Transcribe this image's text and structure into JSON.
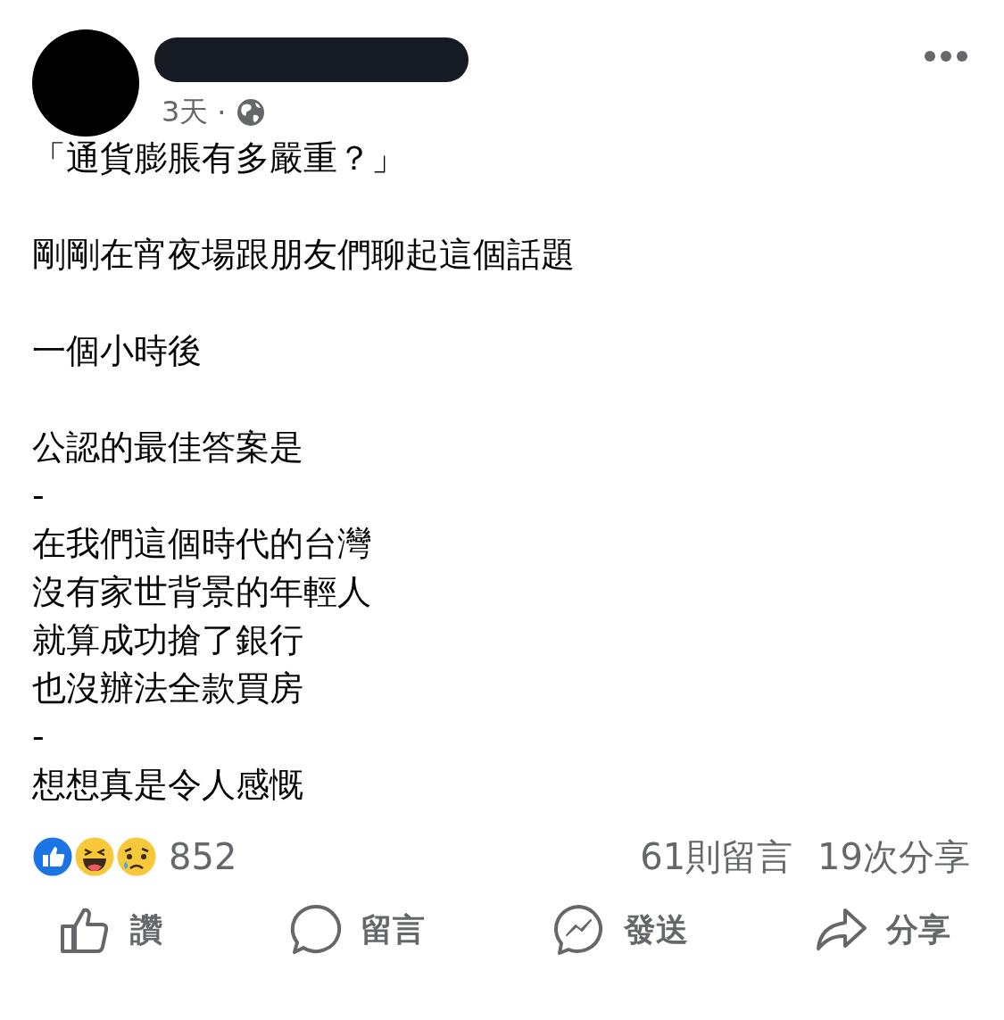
{
  "post": {
    "time": "3天",
    "separator": "·",
    "paragraphs": [
      [
        "「通貨膨脹有多嚴重？」"
      ],
      [
        "剛剛在宵夜場跟朋友們聊起這個話題"
      ],
      [
        "一個小時後"
      ],
      [
        "公認的最佳答案是",
        "-",
        "在我們這個時代的台灣",
        "沒有家世背景的年輕人",
        "就算成功搶了銀行",
        "也沒辦法全款買房",
        "-",
        "想想真是令人感慨"
      ]
    ]
  },
  "reactions": {
    "icons": [
      {
        "kind": "like"
      },
      {
        "kind": "haha"
      },
      {
        "kind": "sad"
      }
    ],
    "count": "852",
    "comments": "61則留言",
    "shares": "19次分享"
  },
  "actions": [
    {
      "kind": "like",
      "label": "讚"
    },
    {
      "kind": "comment",
      "label": "留言"
    },
    {
      "kind": "send",
      "label": "發送"
    },
    {
      "kind": "share",
      "label": "分享"
    }
  ]
}
